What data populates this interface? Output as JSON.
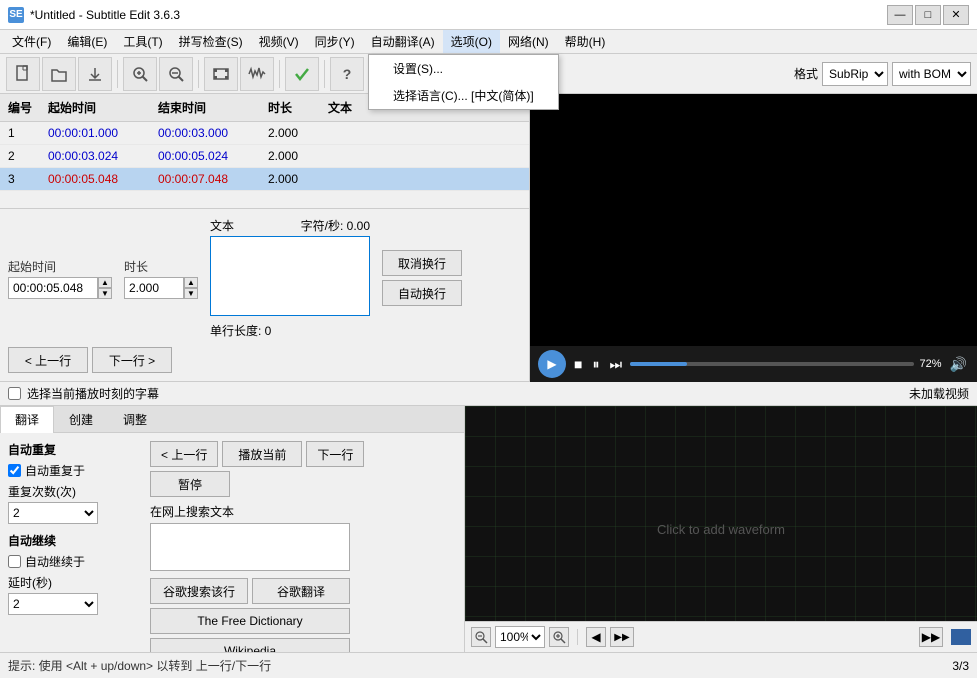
{
  "titleBar": {
    "title": "*Untitled - Subtitle Edit 3.6.3",
    "iconLabel": "SE",
    "minBtn": "—",
    "maxBtn": "□",
    "closeBtn": "✕"
  },
  "menuBar": {
    "items": [
      {
        "id": "file",
        "label": "文件(F)"
      },
      {
        "id": "edit",
        "label": "编辑(E)"
      },
      {
        "id": "tools",
        "label": "工具(T)"
      },
      {
        "id": "spell",
        "label": "拼写检查(S)"
      },
      {
        "id": "video",
        "label": "视频(V)"
      },
      {
        "id": "sync",
        "label": "同步(Y)"
      },
      {
        "id": "autotrans",
        "label": "自动翻译(A)"
      },
      {
        "id": "options",
        "label": "选项(O)",
        "active": true
      },
      {
        "id": "network",
        "label": "网络(N)"
      },
      {
        "id": "help",
        "label": "帮助(H)"
      }
    ],
    "optionsDropdown": {
      "items": [
        {
          "id": "settings",
          "label": "设置(S)..."
        },
        {
          "id": "lang",
          "label": "选择语言(C)... [中文(简体)]"
        }
      ]
    }
  },
  "toolbar": {
    "formatLabel": "格式",
    "formatValue": "SubRip",
    "bomValue": "with BOM",
    "icons": {
      "new": "📄",
      "open": "📂",
      "download": "⬇",
      "zoomIn": "🔍",
      "zoomOut": "🔍",
      "film": "🎬",
      "check": "✓",
      "help": "?"
    }
  },
  "table": {
    "headers": [
      "编号",
      "起始时间",
      "结束时间",
      "时长",
      "文本"
    ],
    "rows": [
      {
        "num": "1",
        "start": "00:00:01.000",
        "end": "00:00:03.000",
        "duration": "2.000",
        "text": ""
      },
      {
        "num": "2",
        "start": "00:00:03.024",
        "end": "00:00:05.024",
        "duration": "2.000",
        "text": ""
      },
      {
        "num": "3",
        "start": "00:00:05.048",
        "end": "00:00:07.048",
        "duration": "2.000",
        "text": "",
        "selected": true
      }
    ]
  },
  "editArea": {
    "startTimeLabel": "起始时间",
    "durationLabel": "时长",
    "textLabel": "文本",
    "charsPerSecLabel": "字符/秒:",
    "charsPerSecValue": "0.00",
    "startTimeValue": "00:00:05.048",
    "durationValue": "2.000",
    "cancelWrapBtn": "取消换行",
    "autoWrapBtn": "自动换行",
    "singleLengthLabel": "单行长度: 0",
    "prevRowBtn": "< 上一行",
    "nextRowBtn": "下一行 >"
  },
  "rightPanel": {
    "videoPlaceholder": "",
    "timeDisplay": "72%",
    "controls": {
      "play": "▶",
      "stop": "■",
      "pause": "⏸",
      "skipNext": "⏭"
    }
  },
  "bottomPanel": {
    "tabs": [
      {
        "id": "translate",
        "label": "翻译",
        "active": true
      },
      {
        "id": "create",
        "label": "创建"
      },
      {
        "id": "adjust",
        "label": "调整"
      }
    ],
    "subtitleCheckLabel": "选择当前播放时刻的字幕",
    "noVideoLabel": "未加载视频",
    "autoRepeat": {
      "title": "自动重复",
      "checkbox": "自动重复于",
      "repeatCountLabel": "重复次数(次)",
      "repeatCountValue": "2"
    },
    "autoContinue": {
      "title": "自动继续",
      "checkbox": "自动继续于",
      "delayLabel": "延时(秒)",
      "delayValue": "2"
    },
    "translationControls": {
      "prevBtn": "< 上一行",
      "playCurrentBtn": "播放当前",
      "nextBtn": "下一行",
      "pauseBtn": "暂停",
      "searchLabel": "在网上搜索文本",
      "googleSearchBtn": "谷歌搜索该行",
      "googleTranslateBtn": "谷歌翻译",
      "freeDictBtn": "The Free Dictionary",
      "wikipediaBtn": "Wikipedia"
    },
    "waveform": {
      "placeholder": "Click to add waveform"
    }
  },
  "statusBar": {
    "hint": "提示: 使用 <Alt + up/down> 以转到 上一行/下一行",
    "count": "3/3"
  },
  "zoomBar": {
    "zoomLevel": "100%",
    "zoomIn": "+",
    "zoomOut": "-"
  }
}
